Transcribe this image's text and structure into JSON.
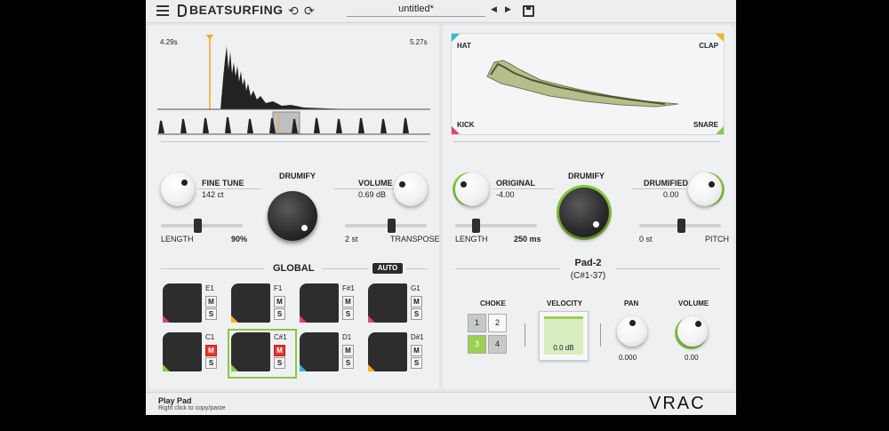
{
  "app": {
    "brand": "BEATSURFING",
    "file_name": "untitled*"
  },
  "waveform": {
    "start_time": "4.29s",
    "end_time": "5.27s"
  },
  "left": {
    "fine_tune": {
      "label": "FINE TUNE",
      "value": "142 ct"
    },
    "drumify_label": "DRUMIFY",
    "volume": {
      "label": "VOLUME",
      "value": "0.69 dB"
    },
    "length": {
      "label": "LENGTH",
      "value": "90%",
      "fraction": 0.9
    },
    "transpose": {
      "label": "TRANSPOSE",
      "value": "2 st"
    },
    "global_label": "GLOBAL",
    "auto_label": "AUTO"
  },
  "pads": [
    {
      "name": "E1",
      "mute": false,
      "color": "#e0407c"
    },
    {
      "name": "F1",
      "mute": false,
      "color": "#f5b21a"
    },
    {
      "name": "F#1",
      "mute": false,
      "color": "#e0407c"
    },
    {
      "name": "G1",
      "mute": false,
      "color": "#e0407c"
    },
    {
      "name": "C1",
      "mute": true,
      "color": "#8ac840"
    },
    {
      "name": "C#1",
      "mute": true,
      "color": "#8ac840",
      "selected": true
    },
    {
      "name": "D1",
      "mute": false,
      "color": "#30b8d0"
    },
    {
      "name": "D#1",
      "mute": false,
      "color": "#f5b21a"
    }
  ],
  "pad_labels": {
    "mute": "M",
    "solo": "S"
  },
  "xy": {
    "hat": "HAT",
    "clap": "CLAP",
    "kick": "KICK",
    "snare": "SNARE"
  },
  "right": {
    "original": {
      "label": "ORIGINAL",
      "value": "-4.00"
    },
    "drumify_label": "DRUMIFY",
    "drumified": {
      "label": "DRUMIFIED",
      "value": "0.00"
    },
    "length": {
      "label": "LENGTH",
      "value": "250 ms"
    },
    "pitch": {
      "label": "PITCH",
      "value": "0 st"
    },
    "pad_title": "Pad-2",
    "pad_note": "(C#1-37)",
    "choke": {
      "label": "CHOKE",
      "cells": [
        "1",
        "2",
        "3",
        "4"
      ]
    },
    "velocity": {
      "label": "VELOCITY",
      "value": "0.0 dB"
    },
    "pan": {
      "label": "PAN",
      "value": "0.000"
    },
    "volume": {
      "label": "VOLUME",
      "value": "0.00"
    }
  },
  "status": {
    "title": "Play Pad",
    "hint": "Right click to copy/paste"
  },
  "logo": "VRAC",
  "colors": {
    "accent_green": "#8ac840",
    "marker_orange": "#f5a623",
    "mute_red": "#e2382f"
  }
}
